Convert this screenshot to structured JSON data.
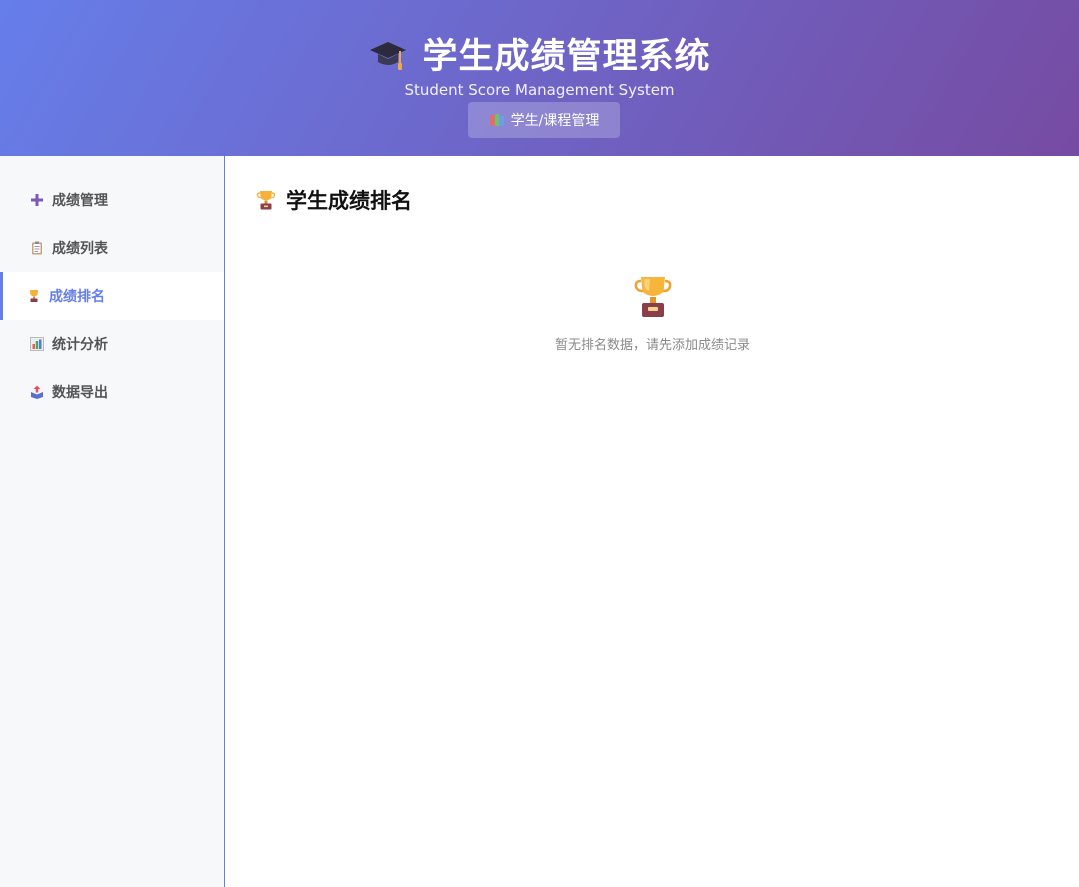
{
  "header": {
    "title": "学生成绩管理系统",
    "subtitle": "Student Score Management System",
    "nav_button": "学生/课程管理",
    "icon": "graduation-cap-icon"
  },
  "sidebar": {
    "items": [
      {
        "label": "成绩管理",
        "icon": "plus-icon",
        "active": false
      },
      {
        "label": "成绩列表",
        "icon": "clipboard-icon",
        "active": false
      },
      {
        "label": "成绩排名",
        "icon": "trophy-icon",
        "active": true
      },
      {
        "label": "统计分析",
        "icon": "bar-chart-icon",
        "active": false
      },
      {
        "label": "数据导出",
        "icon": "export-box-icon",
        "active": false
      }
    ]
  },
  "main": {
    "title": "学生成绩排名",
    "title_icon": "trophy-icon",
    "empty_icon": "trophy-icon",
    "empty_message": "暂无排名数据，请先添加成绩记录"
  },
  "colors": {
    "gradient_start": "#667eea",
    "gradient_end": "#764ba2",
    "accent": "#667eea",
    "sidebar_bg": "#f7f8fa"
  }
}
